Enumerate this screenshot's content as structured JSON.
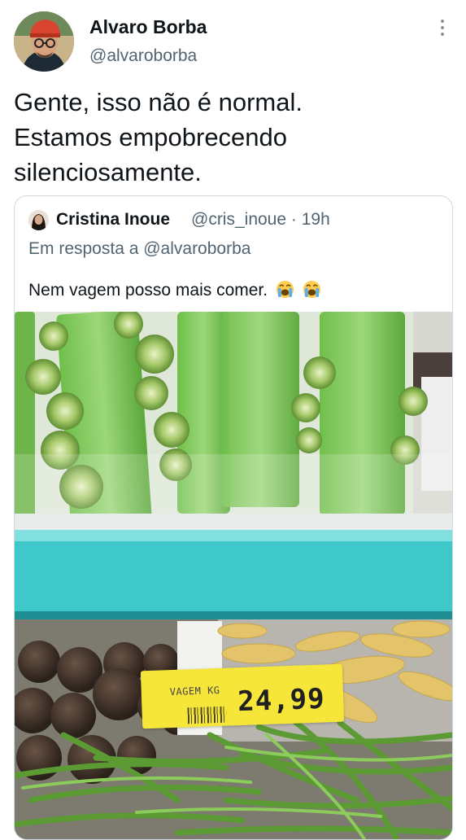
{
  "tweet": {
    "author_name": "Alvaro Borba",
    "author_handle": "@alvaroborba",
    "text_lines": [
      "Gente, isso não é normal.",
      "Estamos empobrecendo",
      "silenciosamente."
    ],
    "more_icon": "more-vertical-icon"
  },
  "quoted_tweet": {
    "author_name": "Cristina Inoue",
    "author_handle": "@cris_inoue",
    "separator": "·",
    "time": "19h",
    "reply_to": "Em resposta a @alvaroborba",
    "text": "Nem vagem posso mais comer.",
    "emojis": [
      "crying-face-emoji",
      "crying-face-emoji"
    ]
  },
  "photo": {
    "price_tag_name": "VAGEM KG",
    "price_tag_value": "24,99",
    "tag_color": "#f6e63a",
    "shelf_color": "#3ec8c9"
  }
}
